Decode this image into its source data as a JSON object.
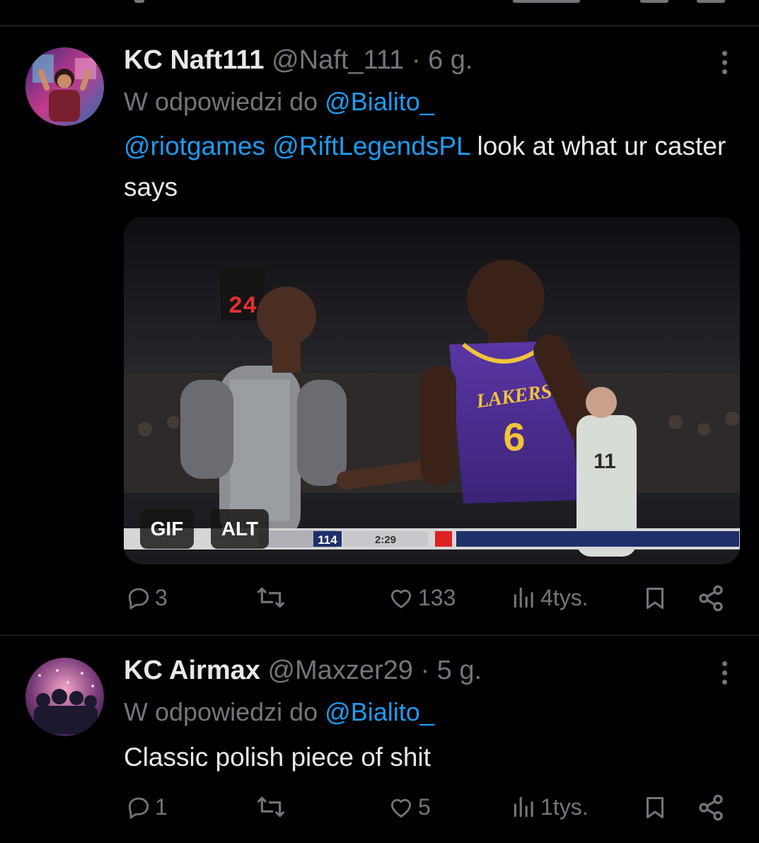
{
  "tweets": [
    {
      "name": "KC Naft111",
      "handle": "@Naft_111",
      "dot": "·",
      "time": "6 g.",
      "reply_prefix": "W odpowiedzi do",
      "reply_to": "@Bialito_",
      "mentions": [
        "@riotgames",
        "@RiftLegendsPL"
      ],
      "text": " look at what ur caster says",
      "media": {
        "badges": [
          "GIF",
          "ALT"
        ],
        "scoreboard": "114",
        "clock": "2:29",
        "shot_clock": "24",
        "jersey_team": "LAKERS",
        "jersey_number": "6",
        "opponent_number": "11"
      },
      "stats": {
        "replies": "3",
        "likes": "133",
        "views": "4tys."
      }
    },
    {
      "name": "KC Airmax",
      "handle": "@Maxzer29",
      "dot": "·",
      "time": "5 g.",
      "reply_prefix": "W odpowiedzi do",
      "reply_to": "@Bialito_",
      "text": "Classic polish piece of shit",
      "stats": {
        "replies": "1",
        "likes": "5",
        "views": "1tys."
      }
    }
  ],
  "icons": [
    "reply-icon",
    "retweet-icon",
    "like-icon",
    "views-icon",
    "bookmark-icon",
    "share-icon",
    "more-icon"
  ],
  "colors": {
    "background": "#000000",
    "text": "#e7e9ea",
    "muted": "#71767b",
    "link": "#1d9bf0",
    "divider": "#2f3336"
  }
}
